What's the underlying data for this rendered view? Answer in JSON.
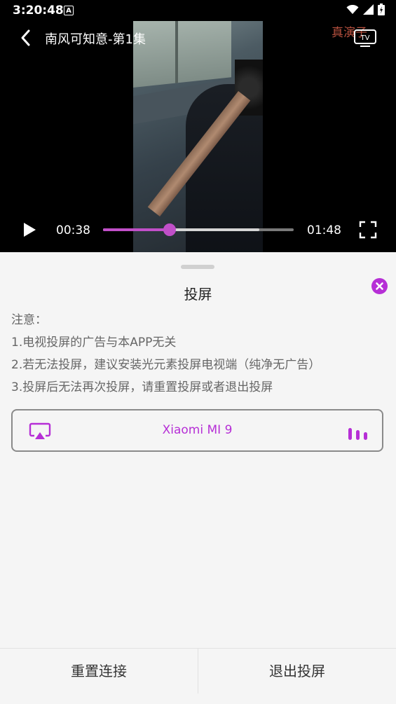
{
  "status_bar": {
    "time": "3:20:48",
    "notification_icon": "A"
  },
  "video": {
    "title": "南风可知意-第1集",
    "watermark": "真演子",
    "current_time": "00:38",
    "total_time": "01:48",
    "progress": 0.35,
    "buffered": 0.82
  },
  "cast_panel": {
    "title": "投屏",
    "notes": [
      "注意：",
      "1.电视投屏的广告与本APP无关",
      "2.若无法投屏，建议安装光元素投屏电视端（纯净无广告）",
      "3.投屏后无法再次投屏，请重置投屏或者退出投屏"
    ],
    "device": {
      "name": "Xiaomi MI 9"
    },
    "buttons": {
      "reset": "重置连接",
      "exit": "退出投屏"
    }
  },
  "colors": {
    "accent": "#b62fd6",
    "progress": "#c14fc9"
  }
}
